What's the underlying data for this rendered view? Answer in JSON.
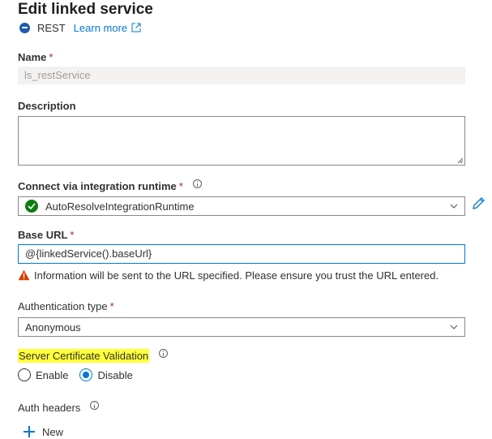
{
  "header": {
    "title": "Edit linked service",
    "service_type": "REST",
    "learn_more": "Learn more"
  },
  "fields": {
    "name": {
      "label": "Name",
      "required_mark": "*",
      "value": "ls_restService"
    },
    "description": {
      "label": "Description",
      "value": ""
    },
    "integration_runtime": {
      "label": "Connect via integration runtime",
      "required_mark": "*",
      "value": "AutoResolveIntegrationRuntime"
    },
    "base_url": {
      "label": "Base URL",
      "required_mark": "*",
      "value": "@{linkedService().baseUrl}",
      "warning": "Information will be sent to the URL specified. Please ensure you trust the URL entered."
    },
    "authentication_type": {
      "label": "Authentication type",
      "required_mark": "*",
      "value": "Anonymous"
    },
    "server_certificate_validation": {
      "label": "Server Certificate Validation",
      "options": [
        "Enable",
        "Disable"
      ],
      "selected": "Disable"
    },
    "auth_headers": {
      "label": "Auth headers",
      "new_button": "New"
    }
  },
  "colors": {
    "accent": "#0078d4",
    "required": "#a4262c",
    "success": "#107c10",
    "warning": "#d83b01",
    "highlight": "#ffff3b"
  },
  "icons": {
    "service": "rest-icon",
    "learn_more": "external-link-icon",
    "runtime_status": "check-circle-icon",
    "edit": "pencil-icon",
    "warning": "warning-icon",
    "info": "info-icon",
    "add": "plus-icon"
  }
}
